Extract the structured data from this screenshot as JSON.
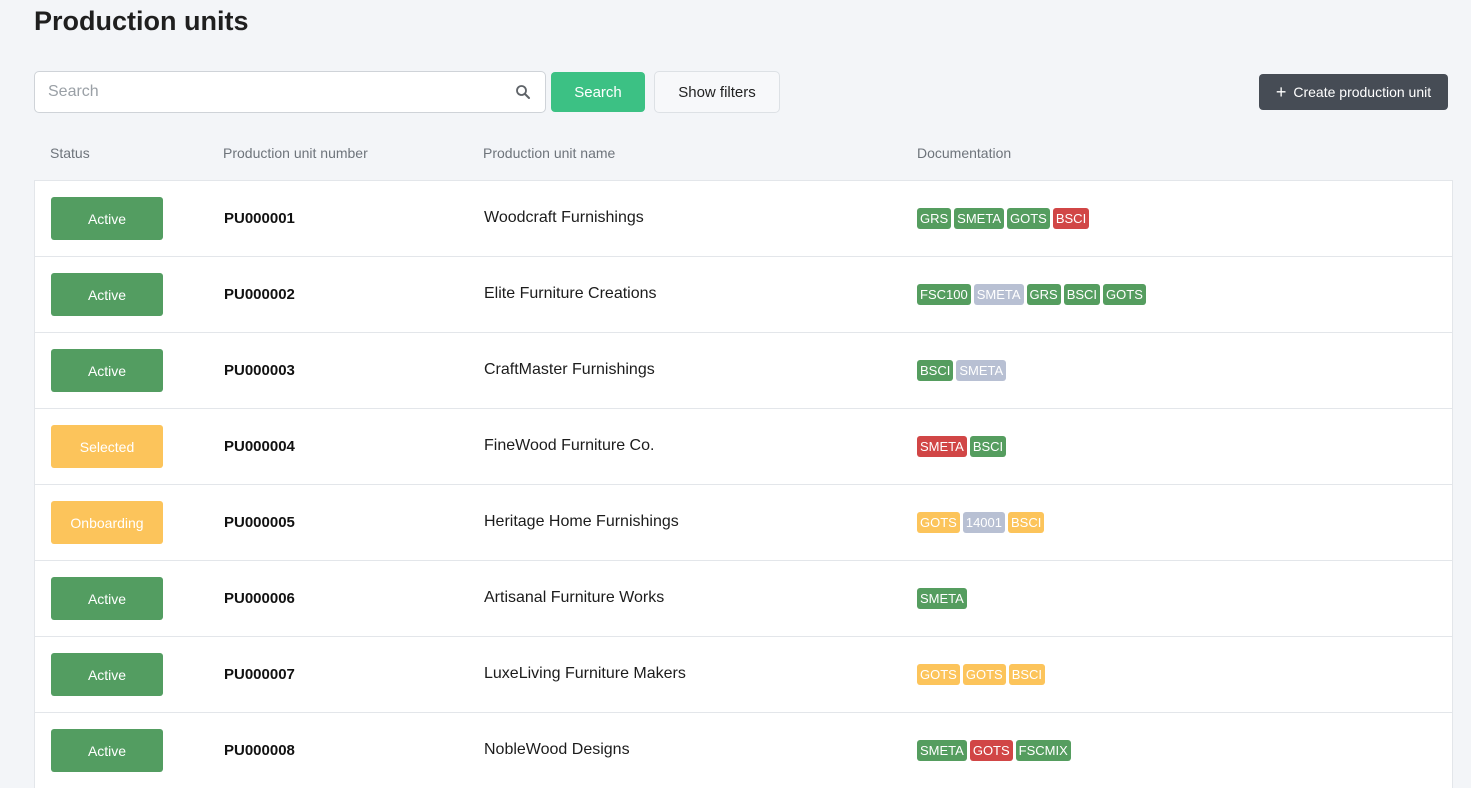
{
  "page": {
    "title": "Production units"
  },
  "toolbar": {
    "search_placeholder": "Search",
    "search_label": "Search",
    "filters_label": "Show filters",
    "create_label": "Create production unit"
  },
  "columns": {
    "status": "Status",
    "number": "Production unit number",
    "name": "Production unit name",
    "documentation": "Documentation"
  },
  "colors": {
    "Active": "#539d61",
    "Selected": "#fcc45b",
    "Onboarding": "#fcc45b",
    "green": "#559d5f",
    "red": "#d14646",
    "gray": "#b8c0d3",
    "yellow": "#fcc45b"
  },
  "rows": [
    {
      "status": "Active",
      "number": "PU000001",
      "name": "Woodcraft Furnishings",
      "docs": [
        {
          "label": "GRS",
          "color": "green"
        },
        {
          "label": "SMETA",
          "color": "green"
        },
        {
          "label": "GOTS",
          "color": "green"
        },
        {
          "label": "BSCI",
          "color": "red"
        }
      ]
    },
    {
      "status": "Active",
      "number": "PU000002",
      "name": "Elite Furniture Creations",
      "docs": [
        {
          "label": "FSC100",
          "color": "green"
        },
        {
          "label": "SMETA",
          "color": "gray"
        },
        {
          "label": "GRS",
          "color": "green"
        },
        {
          "label": "BSCI",
          "color": "green"
        },
        {
          "label": "GOTS",
          "color": "green"
        }
      ]
    },
    {
      "status": "Active",
      "number": "PU000003",
      "name": "CraftMaster Furnishings",
      "docs": [
        {
          "label": "BSCI",
          "color": "green"
        },
        {
          "label": "SMETA",
          "color": "gray"
        }
      ]
    },
    {
      "status": "Selected",
      "number": "PU000004",
      "name": "FineWood Furniture Co.",
      "docs": [
        {
          "label": "SMETA",
          "color": "red"
        },
        {
          "label": "BSCI",
          "color": "green"
        }
      ]
    },
    {
      "status": "Onboarding",
      "number": "PU000005",
      "name": "Heritage Home Furnishings",
      "docs": [
        {
          "label": "GOTS",
          "color": "yellow"
        },
        {
          "label": "14001",
          "color": "gray"
        },
        {
          "label": "BSCI",
          "color": "yellow"
        }
      ]
    },
    {
      "status": "Active",
      "number": "PU000006",
      "name": "Artisanal Furniture Works",
      "docs": [
        {
          "label": "SMETA",
          "color": "green"
        }
      ]
    },
    {
      "status": "Active",
      "number": "PU000007",
      "name": "LuxeLiving Furniture Makers",
      "docs": [
        {
          "label": "GOTS",
          "color": "yellow"
        },
        {
          "label": "GOTS",
          "color": "yellow"
        },
        {
          "label": "BSCI",
          "color": "yellow"
        }
      ]
    },
    {
      "status": "Active",
      "number": "PU000008",
      "name": "NobleWood Designs",
      "docs": [
        {
          "label": "SMETA",
          "color": "green"
        },
        {
          "label": "GOTS",
          "color": "red"
        },
        {
          "label": "FSCMIX",
          "color": "green"
        }
      ]
    }
  ]
}
